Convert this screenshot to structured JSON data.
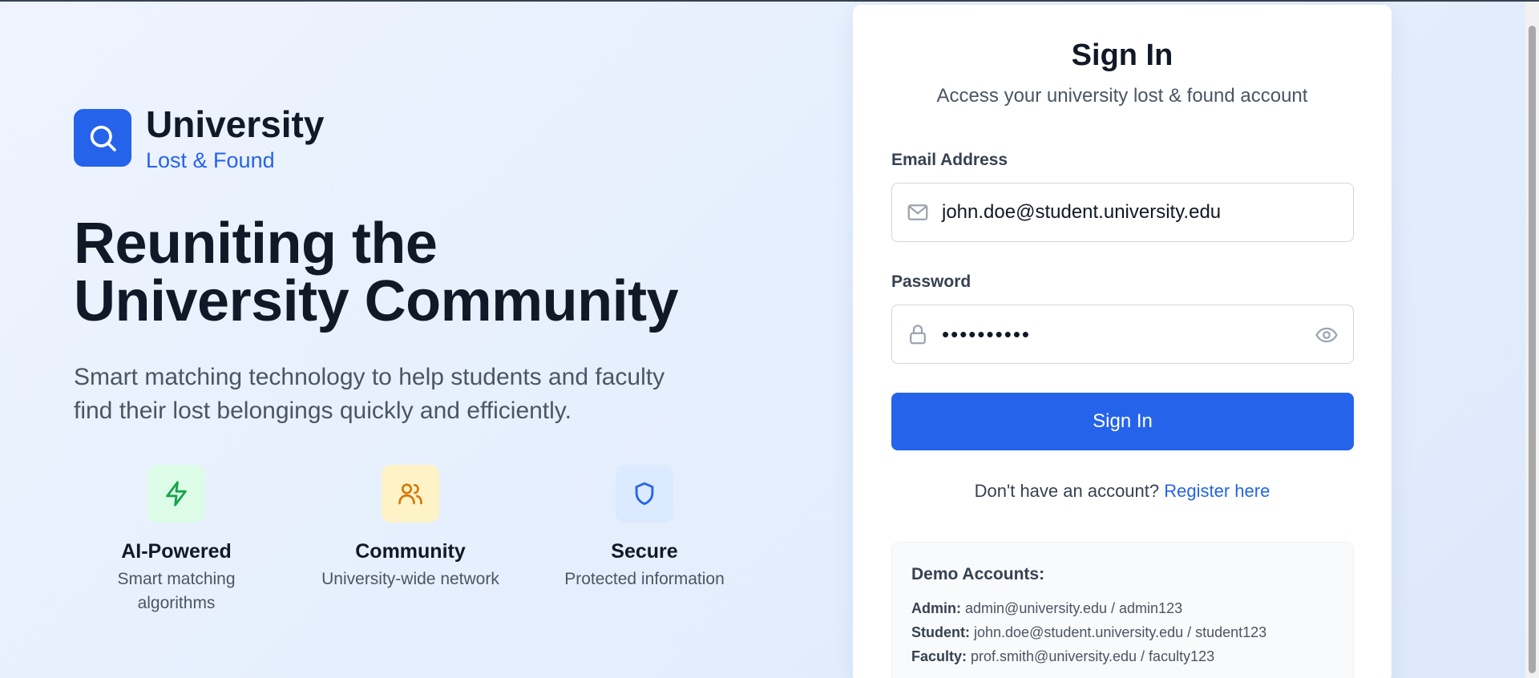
{
  "brand": {
    "name": "University",
    "subtitle": "Lost & Found",
    "logo_icon": "search-icon",
    "accent_color": "#2563eb"
  },
  "hero": {
    "title_line1": "Reuniting the",
    "title_line2": "University Community",
    "subtitle_line1": "Smart matching technology to help students and faculty",
    "subtitle_line2": "find their lost belongings quickly and efficiently."
  },
  "features": [
    {
      "icon": "lightning-icon",
      "title": "AI-Powered",
      "desc_line1": "Smart matching",
      "desc_line2": "algorithms",
      "color": "#16a34a"
    },
    {
      "icon": "users-icon",
      "title": "Community",
      "desc_line1": "University-wide network",
      "desc_line2": "",
      "color": "#d97706"
    },
    {
      "icon": "shield-icon",
      "title": "Secure",
      "desc_line1": "Protected information",
      "desc_line2": "",
      "color": "#2563eb"
    }
  ],
  "signin": {
    "title": "Sign In",
    "subtitle": "Access your university lost & found account",
    "email_label": "Email Address",
    "email_value": "john.doe@student.university.edu",
    "password_label": "Password",
    "password_value": "••••••••••",
    "button_label": "Sign In",
    "register_prompt": "Don't have an account?",
    "register_link": "Register here"
  },
  "demo": {
    "title": "Demo Accounts:",
    "accounts": [
      {
        "role": "Admin:",
        "credentials": "admin@university.edu / admin123"
      },
      {
        "role": "Student:",
        "credentials": "john.doe@student.university.edu / student123"
      },
      {
        "role": "Faculty:",
        "credentials": "prof.smith@university.edu / faculty123"
      }
    ]
  }
}
